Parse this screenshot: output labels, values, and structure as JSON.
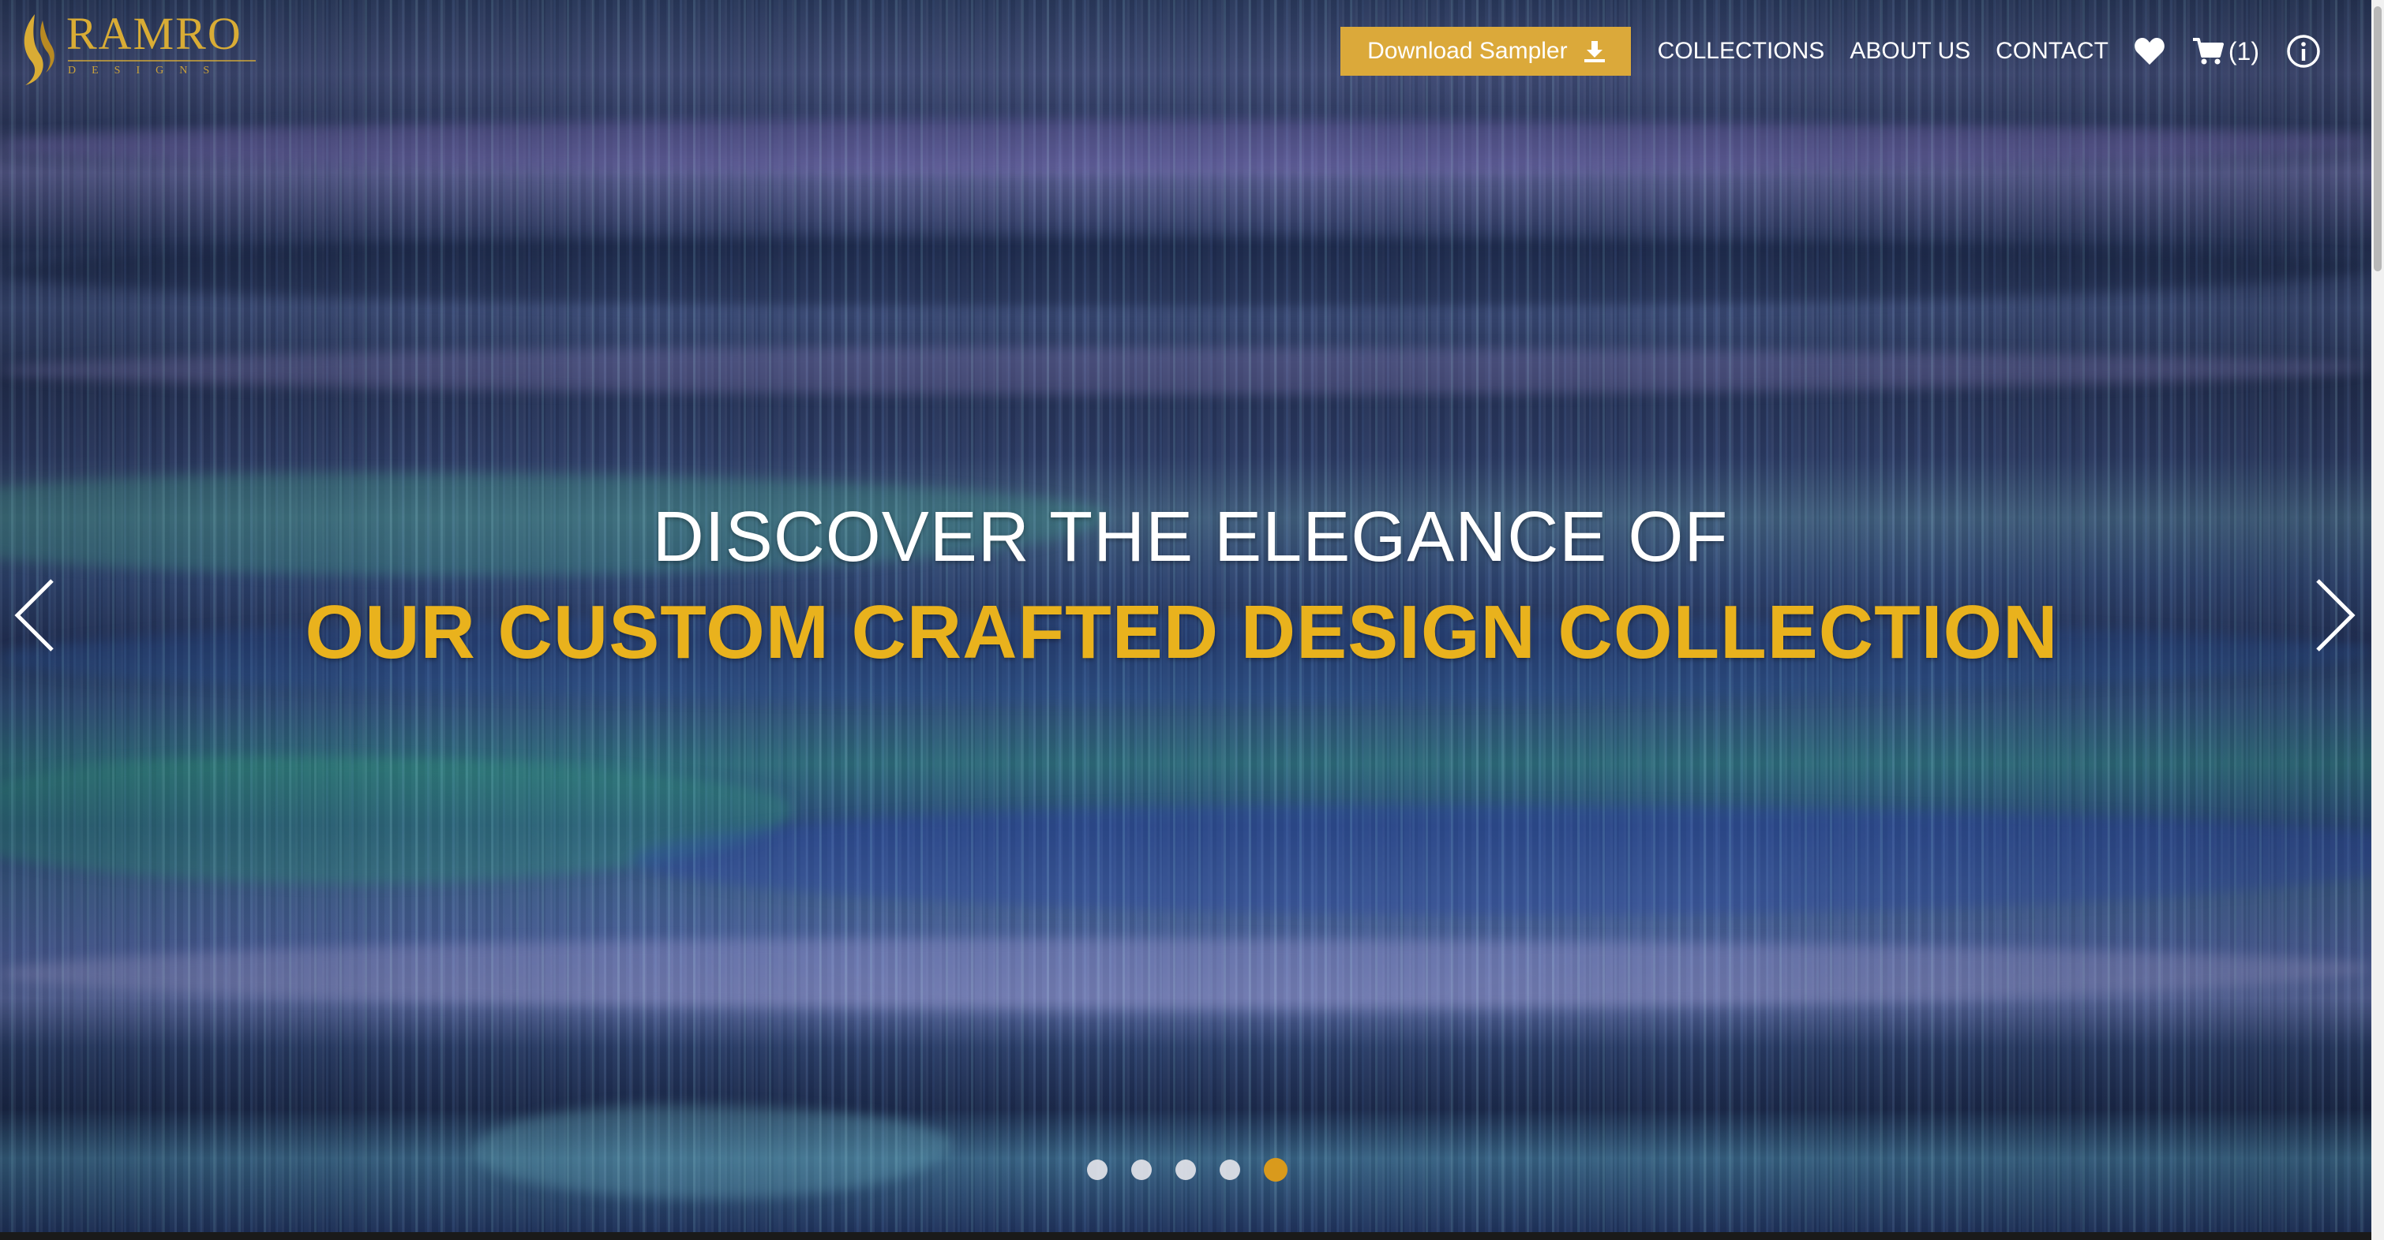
{
  "brand": {
    "name": "RAMRO",
    "tagline": "DESIGNS",
    "color": "#d9ac35"
  },
  "nav": {
    "sampler_label": "Download Sampler",
    "sampler_icon": "download-icon",
    "links": [
      "COLLECTIONS",
      "ABOUT US",
      "CONTACT"
    ],
    "wishlist_icon": "heart-icon",
    "cart_icon": "cart-icon",
    "cart_count": "(1)",
    "info_icon": "info-icon"
  },
  "hero": {
    "line1": "DISCOVER THE ELEGANCE OF",
    "line2": "OUR CUSTOM CRAFTED DESIGN COLLECTION",
    "line2_color": "#e9b21d"
  },
  "carousel": {
    "prev_icon": "chevron-left-icon",
    "next_icon": "chevron-right-icon",
    "slide_count": 5,
    "active_slide": 5,
    "active_dot_color": "#d99a1c"
  }
}
